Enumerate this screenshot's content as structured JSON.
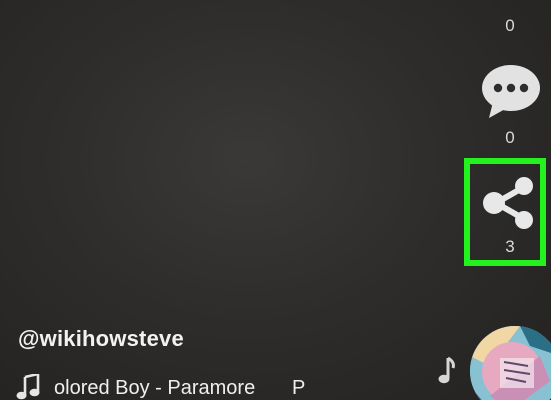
{
  "actions": {
    "like_count": "0",
    "comment_count": "0",
    "share_count": "3"
  },
  "author": {
    "username": "@wikihowsteve"
  },
  "music": {
    "title": "olored Boy - Paramore",
    "title_repeat": "P"
  },
  "icons": {
    "comment": "comment-bubble-icon",
    "share": "share-icon",
    "music": "music-note-icon",
    "sound_disc": "album-art-disc"
  },
  "colors": {
    "highlight": "#23f21f",
    "icon": "#e0e0e0"
  }
}
